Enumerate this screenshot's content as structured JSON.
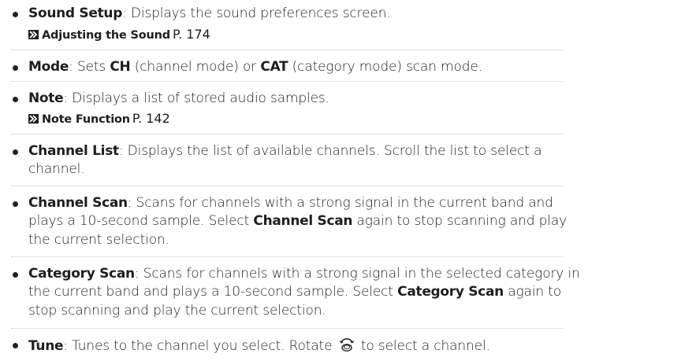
{
  "items": [
    {
      "term": "Sound Setup",
      "description": ": Displays the sound preferences screen.",
      "ref": {
        "title": "Adjusting the Sound",
        "page": "P. 174"
      }
    },
    {
      "term": "Mode",
      "description_parts": [
        {
          "t": ": Sets ",
          "b": false
        },
        {
          "t": "CH",
          "b": true
        },
        {
          "t": " (channel mode) or ",
          "b": false
        },
        {
          "t": "CAT",
          "b": true
        },
        {
          "t": " (category mode) scan mode.",
          "b": false
        }
      ]
    },
    {
      "term": "Note",
      "description": ": Displays a list of stored audio samples.",
      "ref": {
        "title": "Note Function",
        "page": "P. 142"
      }
    },
    {
      "term": "Channel List",
      "description_line1": ": Displays the list of available channels. Scroll the list to select a",
      "description_line2": "channel."
    },
    {
      "term": "Channel Scan",
      "line1": ": Scans for channels with a strong signal in the current band and",
      "line2_a": "plays a 10-second sample. Select ",
      "line2_term": "Channel Scan",
      "line2_b": " again to stop scanning and play",
      "line3": "the current selection."
    },
    {
      "term": "Category Scan",
      "line1": ": Scans for channels with a strong signal in the selected category in",
      "line2_a": "the current band and plays a 10-second sample. Select ",
      "line2_term": "Category Scan",
      "line2_b": " again to",
      "line3": "stop scanning and play the current selection."
    },
    {
      "term": "Tune",
      "desc_a": ": Tunes to the channel you select. Rotate ",
      "icon": "selector-knob-icon",
      "desc_b": " to select a channel."
    }
  ]
}
